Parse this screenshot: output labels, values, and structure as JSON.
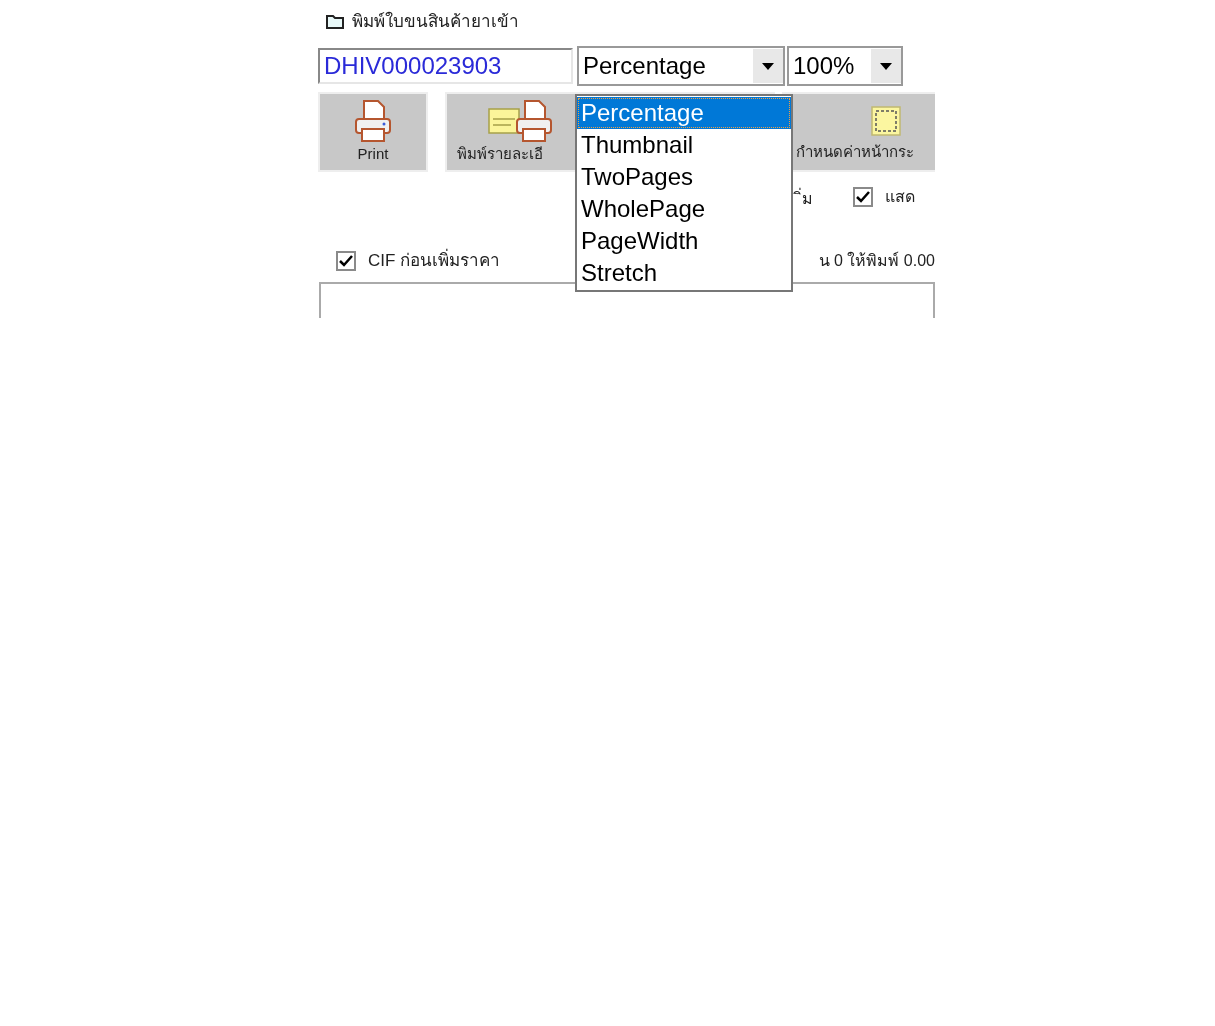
{
  "title": "พิมพ์ใบขนสินค้ายาเข้า",
  "document_number": "DHIV000023903",
  "view_mode": {
    "value": "Percentage",
    "options": [
      {
        "label": "Percentage",
        "selected": true
      },
      {
        "label": "Thumbnail",
        "selected": false
      },
      {
        "label": "TwoPages",
        "selected": false
      },
      {
        "label": "WholePage",
        "selected": false
      },
      {
        "label": "PageWidth",
        "selected": false
      },
      {
        "label": "Stretch",
        "selected": false
      }
    ]
  },
  "zoom": "100%",
  "toolbar": [
    {
      "kind": "print",
      "label": "Print"
    },
    {
      "kind": "print-detail",
      "label": "พิมพ์รายละเอี"
    },
    {
      "kind": "page-setup",
      "label": "กำหนดค่าหน้ากระ"
    }
  ],
  "row_1": {
    "text": "ิ่ม",
    "checkbox": {
      "label": "แสด",
      "checked": true
    }
  },
  "row_2": {
    "checkbox": {
      "label": "CIF ก่อนเพิ่มราคา",
      "checked": true
    },
    "text": "น 0 ให้พิมพ์ 0.00"
  }
}
